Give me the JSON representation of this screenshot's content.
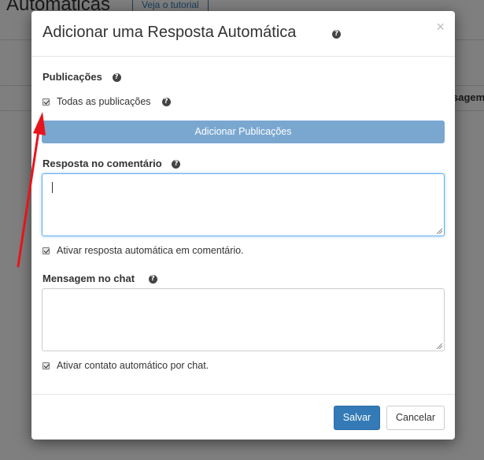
{
  "background": {
    "page_title": "Automáticas",
    "tutorial_button": "Veja o tutorial",
    "column_label": "sagem"
  },
  "modal": {
    "title": "Adicionar uma Resposta Automática",
    "close_glyph": "×",
    "help_glyph": "?",
    "publications": {
      "label": "Publicações",
      "all_checkbox_label": "Todas as publicações",
      "all_checked": true,
      "add_button": "Adicionar Publicações"
    },
    "comment_reply": {
      "label": "Resposta no comentário",
      "value": "",
      "enable_checkbox_label": "Ativar resposta automática em comentário.",
      "enable_checked": true
    },
    "chat_message": {
      "label": "Mensagem no chat",
      "value": "",
      "enable_checkbox_label": "Ativar contato automático por chat.",
      "enable_checked": true
    },
    "footer": {
      "save_label": "Salvar",
      "cancel_label": "Cancelar"
    }
  },
  "colors": {
    "primary": "#337ab7",
    "add_button": "#7aa7d0",
    "annotation_arrow": "#e8141b",
    "focus_border": "#66afe9"
  },
  "annotation": {
    "arrow_icon": "red-arrow-icon"
  }
}
